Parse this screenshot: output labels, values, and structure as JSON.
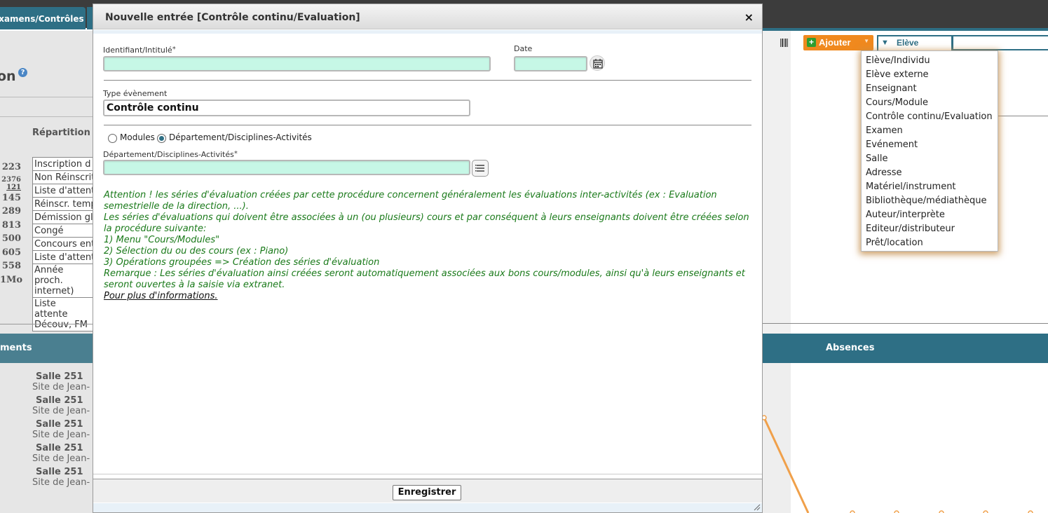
{
  "background": {
    "tab_label": "Examens/Contrôles",
    "page_title": "on",
    "help_icon": "?",
    "repartition_label": "Répartition",
    "stats_numbers": [
      "223",
      "2376",
      "121",
      "145",
      "289",
      "813",
      "500",
      "605",
      "558",
      "1Mo"
    ],
    "stats_rows": [
      "Inscription d",
      "Non Réinscrit",
      "Liste d'attent",
      "Réinscr. temp",
      "Démission gl",
      "Congé",
      "Concours ent",
      "Liste d'attent",
      "Année proch. internet)",
      "Liste attente Découv, FM"
    ],
    "bottom_left_label": "ments",
    "absences_label": "Absences",
    "rooms": [
      {
        "name": "Salle 251",
        "site": "Site de Jean-"
      },
      {
        "name": "Salle 251",
        "site": "Site de Jean-"
      },
      {
        "name": "Salle 251",
        "site": "Site de Jean-"
      },
      {
        "name": "Salle 251",
        "site": "Site de Jean-"
      },
      {
        "name": "Salle 251",
        "site": "Site de Jean-"
      }
    ]
  },
  "toolbar": {
    "add_label": "Ajouter",
    "type_select_value": "Elève",
    "colors": {
      "add": "#f0891e",
      "accent": "#2e6f85"
    }
  },
  "dropdown": {
    "items": [
      "Elève/Individu",
      "Elève externe",
      "Enseignant",
      "Cours/Module",
      "Contrôle continu/Evaluation",
      "Examen",
      "Evénement",
      "Salle",
      "Adresse",
      "Matériel/instrument",
      "Bibliothèque/médiathèque",
      "Auteur/interprète",
      "Editeur/distributeur",
      "Prêt/location"
    ]
  },
  "modal": {
    "title": "Nouvelle entrée [Contrôle continu/Evaluation]",
    "close": "×",
    "identifier_label": "Identifiant/Intitulé",
    "required_mark": "*",
    "identifier_value": "",
    "date_label": "Date",
    "date_value": "",
    "event_type_label": "Type évènement",
    "event_type_value": "Contrôle continu",
    "radio_modules": "Modules",
    "radio_department": "Département/Disciplines-Activités",
    "radio_selected": "Département/Disciplines-Activités",
    "department_label": "Département/Disciplines-Activités",
    "department_value": "",
    "notice_lines": [
      "Attention ! les séries d'évaluation créées par cette procédure concernent généralement les évaluations inter-activités (ex : Evaluation semestrielle de la direction, ...).",
      "Les séries d'évaluations qui doivent être associées à un (ou plusieurs) cours et par conséquent à leurs enseignants doivent être créées selon la procédure suivante:",
      "1) Menu \"Cours/Modules\"",
      "2) Sélection du ou des cours (ex : Piano)",
      "3) Opérations groupées => Création des séries d'évaluation",
      "Remarque : Les séries d'évaluation ainsi créées seront automatiquement associées aux bons cours/modules, ainsi qu'à leurs enseignants et seront ouvertes à la saisie via extranet."
    ],
    "more_info_link": "Pour plus d'informations.",
    "save_label": "Enregistrer",
    "colors": {
      "required_field": "#c6f7e6",
      "notice_text": "#1a7a1a"
    }
  }
}
